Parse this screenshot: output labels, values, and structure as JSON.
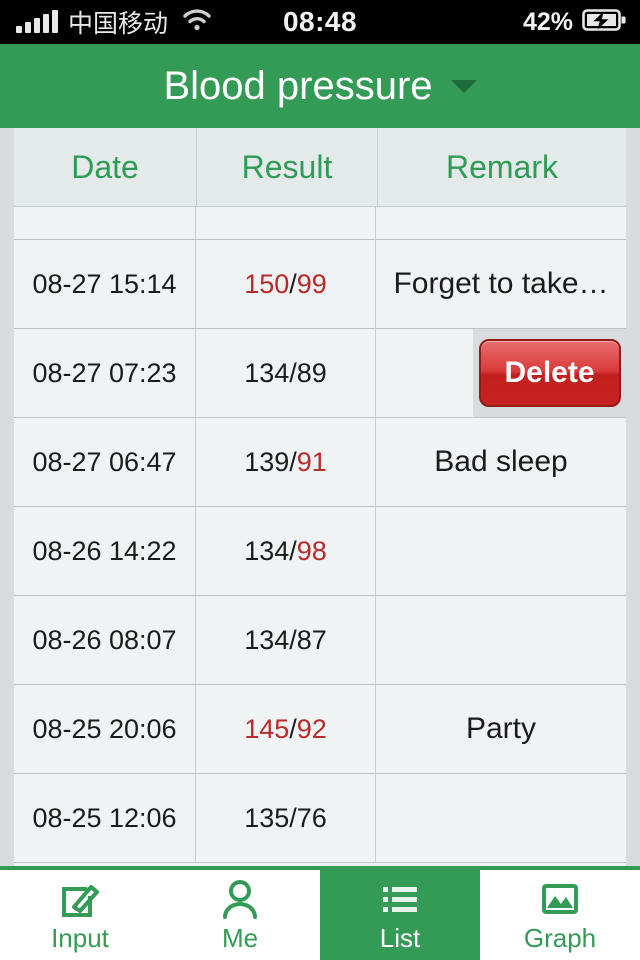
{
  "statusbar": {
    "carrier": "中国移动",
    "time": "08:48",
    "battery_pct": "42%",
    "signal_icon": "signal-bars-icon",
    "wifi_icon": "wifi-icon",
    "battery_icon": "battery-charging-icon"
  },
  "navbar": {
    "title": "Blood pressure",
    "caret_icon": "chevron-down-icon",
    "accent": "#349b56"
  },
  "table": {
    "headers": {
      "date": "Date",
      "result": "Result",
      "remark": "Remark"
    },
    "header_color": "#2f9c55",
    "high_value_color": "#bb2a2a",
    "normal_value_color": "#1b1b1b",
    "rows": [
      {
        "date": "08-27 15:14",
        "systolic": "150",
        "diastolic": "99",
        "systolic_high": true,
        "diastolic_high": true,
        "remark": "Forget to take…",
        "swiped": false
      },
      {
        "date": "08-27 07:23",
        "systolic": "134",
        "diastolic": "89",
        "systolic_high": false,
        "diastolic_high": false,
        "remark": "",
        "swiped": true,
        "delete_label": "Delete"
      },
      {
        "date": "08-27 06:47",
        "systolic": "139",
        "diastolic": "91",
        "systolic_high": false,
        "diastolic_high": true,
        "remark": "Bad sleep",
        "swiped": false
      },
      {
        "date": "08-26 14:22",
        "systolic": "134",
        "diastolic": "98",
        "systolic_high": false,
        "diastolic_high": true,
        "remark": "",
        "swiped": false
      },
      {
        "date": "08-26 08:07",
        "systolic": "134",
        "diastolic": "87",
        "systolic_high": false,
        "diastolic_high": false,
        "remark": "",
        "swiped": false
      },
      {
        "date": "08-25 20:06",
        "systolic": "145",
        "diastolic": "92",
        "systolic_high": true,
        "diastolic_high": true,
        "remark": "Party",
        "swiped": false
      },
      {
        "date": "08-25 12:06",
        "systolic": "135",
        "diastolic": "76",
        "systolic_high": false,
        "diastolic_high": false,
        "remark": "",
        "swiped": false
      }
    ]
  },
  "tabbar": {
    "tabs": [
      {
        "label": "Input",
        "icon": "edit-square-icon",
        "active": false
      },
      {
        "label": "Me",
        "icon": "person-icon",
        "active": false
      },
      {
        "label": "List",
        "icon": "list-bullets-icon",
        "active": true
      },
      {
        "label": "Graph",
        "icon": "image-chart-icon",
        "active": false
      }
    ]
  }
}
